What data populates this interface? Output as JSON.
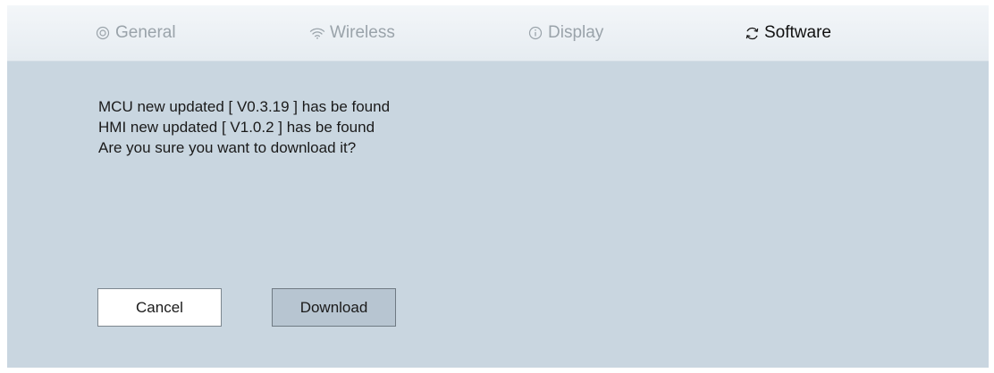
{
  "tabs": {
    "general": {
      "label": "General",
      "icon": "target-icon"
    },
    "wireless": {
      "label": "Wireless",
      "icon": "wifi-icon"
    },
    "display": {
      "label": "Display",
      "icon": "info-icon"
    },
    "software": {
      "label": "Software",
      "icon": "refresh-icon",
      "active": true
    }
  },
  "message": {
    "line1": "MCU new updated [ V0.3.19 ] has be found",
    "line2": "HMI new updated [ V1.0.2 ] has be found",
    "line3": "Are you sure you want to download it?"
  },
  "buttons": {
    "cancel_label": "Cancel",
    "download_label": "Download"
  },
  "colors": {
    "background": "#c9d6e0",
    "tabbar": "#eef2f5",
    "inactive_tab_text": "#9aa3aa",
    "active_tab_text": "#111111",
    "download_button": "#b7c5d1"
  }
}
